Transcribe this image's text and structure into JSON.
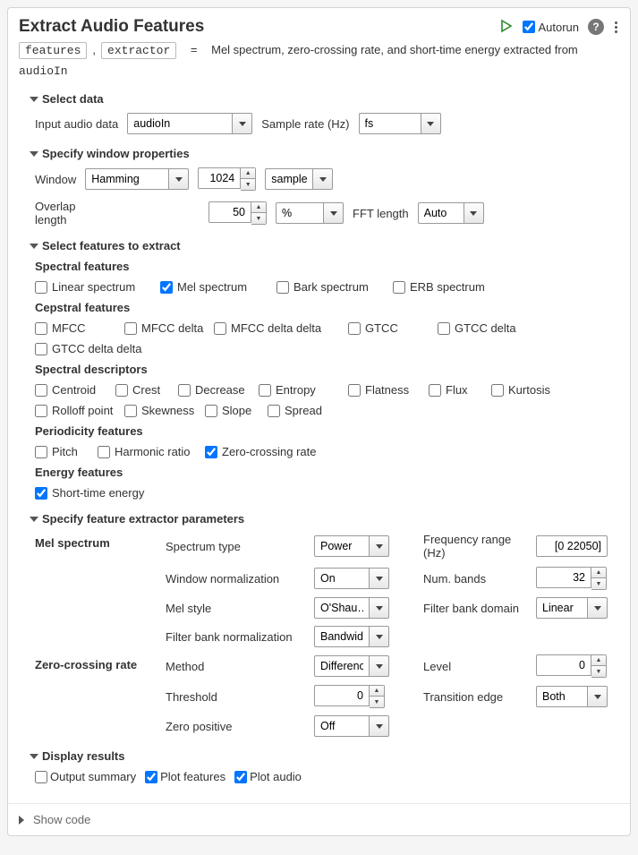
{
  "header": {
    "title": "Extract Audio Features",
    "autorun": "Autorun"
  },
  "signature": {
    "out1": "features",
    "out2": "extractor",
    "eq": "=",
    "desc": "Mel spectrum, zero-crossing rate, and short-time energy extracted from",
    "in": "audioIn"
  },
  "sections": {
    "select_data": "Select data",
    "window_props": "Specify window properties",
    "select_features": "Select features to extract",
    "extractor_params": "Specify feature extractor parameters",
    "display_results": "Display results",
    "show_code": "Show code"
  },
  "labels": {
    "input_audio": "Input audio data",
    "sample_rate": "Sample rate (Hz)",
    "window": "Window",
    "overlap": "Overlap length",
    "fft_length": "FFT length",
    "spectral_features": "Spectral features",
    "cepstral_features": "Cepstral features",
    "spectral_desc": "Spectral descriptors",
    "periodicity": "Periodicity features",
    "energy": "Energy features",
    "mel_spectrum": "Mel spectrum",
    "zcr": "Zero-crossing rate",
    "spectrum_type": "Spectrum type",
    "win_norm": "Window normalization",
    "mel_style": "Mel style",
    "fb_norm": "Filter bank normalization",
    "freq_range": "Frequency range (Hz)",
    "num_bands": "Num. bands",
    "fb_domain": "Filter bank domain",
    "method": "Method",
    "threshold": "Threshold",
    "zero_positive": "Zero positive",
    "level": "Level",
    "transition_edge": "Transition edge"
  },
  "values": {
    "audio_in": "audioIn",
    "fs": "fs",
    "window_type": "Hamming",
    "window_size": "1024",
    "window_unit": "samples",
    "overlap_val": "50",
    "overlap_unit": "%",
    "fft_auto": "Auto",
    "spectrum_type": "Power",
    "win_norm": "On",
    "mel_style": "O'Shau…",
    "fb_norm": "Bandwidth",
    "freq_range": "[0 22050]",
    "num_bands": "32",
    "fb_domain": "Linear",
    "method": "Difference",
    "threshold": "0",
    "zero_positive": "Off",
    "level": "0",
    "transition_edge": "Both"
  },
  "features": {
    "spectral": [
      {
        "label": "Linear spectrum",
        "checked": false
      },
      {
        "label": "Mel spectrum",
        "checked": true
      },
      {
        "label": "Bark spectrum",
        "checked": false
      },
      {
        "label": "ERB spectrum",
        "checked": false
      }
    ],
    "cepstral": [
      {
        "label": "MFCC",
        "checked": false
      },
      {
        "label": "MFCC delta",
        "checked": false
      },
      {
        "label": "MFCC delta delta",
        "checked": false
      },
      {
        "label": "GTCC",
        "checked": false
      },
      {
        "label": "GTCC delta",
        "checked": false
      },
      {
        "label": "GTCC delta delta",
        "checked": false
      }
    ],
    "descriptors": [
      {
        "label": "Centroid"
      },
      {
        "label": "Crest"
      },
      {
        "label": "Decrease"
      },
      {
        "label": "Entropy"
      },
      {
        "label": "Flatness"
      },
      {
        "label": "Flux"
      },
      {
        "label": "Kurtosis"
      },
      {
        "label": "Rolloff point"
      },
      {
        "label": "Skewness"
      },
      {
        "label": "Slope"
      },
      {
        "label": "Spread"
      }
    ],
    "periodicity": [
      {
        "label": "Pitch",
        "checked": false
      },
      {
        "label": "Harmonic ratio",
        "checked": false
      },
      {
        "label": "Zero-crossing rate",
        "checked": true
      }
    ],
    "energy": [
      {
        "label": "Short-time energy",
        "checked": true
      }
    ]
  },
  "display": {
    "output_summary": {
      "label": "Output summary",
      "checked": false
    },
    "plot_features": {
      "label": "Plot features",
      "checked": true
    },
    "plot_audio": {
      "label": "Plot audio",
      "checked": true
    }
  }
}
